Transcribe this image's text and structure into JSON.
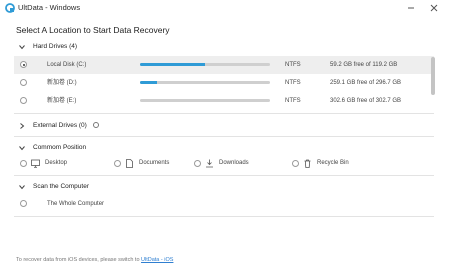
{
  "window": {
    "title": "UltData - Windows"
  },
  "main": {
    "title": "Select A Location to Start Data Recovery"
  },
  "hard_drives": {
    "label": "Hard Drives (4)",
    "drives": [
      {
        "name": "Local Disk (C:)",
        "used_fraction": 0.5,
        "fs": "NTFS",
        "space": "59.2 GB free of 119.2 GB",
        "selected": true
      },
      {
        "name": "新加卷 (D:)",
        "used_fraction": 0.13,
        "fs": "NTFS",
        "space": "259.1 GB free of 296.7 GB",
        "selected": false
      },
      {
        "name": "新加卷 (E:)",
        "used_fraction": 0.0,
        "fs": "NTFS",
        "space": "302.6 GB free of 302.7 GB",
        "selected": false
      }
    ]
  },
  "external_drives": {
    "label": "External Drives (0)"
  },
  "common_position": {
    "label": "Commom Position",
    "items": [
      {
        "label": "Desktop",
        "icon": "desktop-icon"
      },
      {
        "label": "Documents",
        "icon": "document-icon"
      },
      {
        "label": "Downloads",
        "icon": "download-icon"
      },
      {
        "label": "Recycle Bin",
        "icon": "recycle-bin-icon"
      }
    ]
  },
  "scan_computer": {
    "label": "Scan the Computer",
    "item": "The Whole Computer"
  },
  "footer": {
    "text": "To recover data from iOS devices, please switch to ",
    "link": "UltData - iOS"
  },
  "colors": {
    "accent": "#2f9bd6",
    "link": "#2f7fd1"
  }
}
